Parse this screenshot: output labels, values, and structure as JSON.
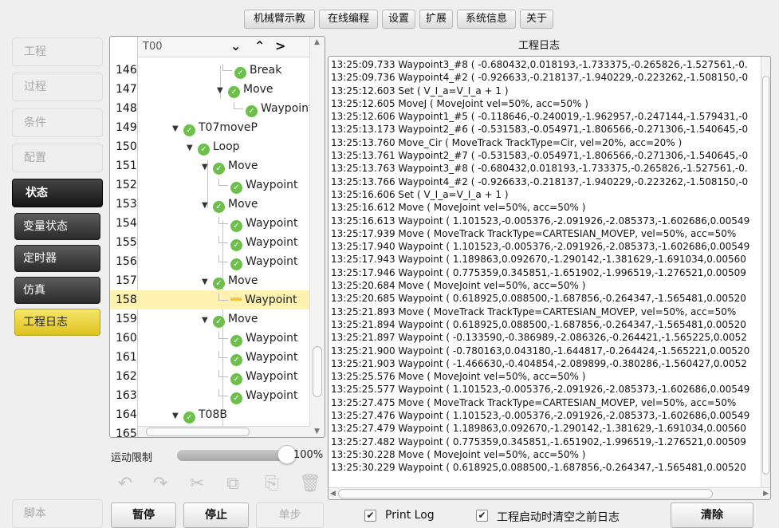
{
  "top_tabs": [
    {
      "label": "机械臂示教",
      "state": "disabled"
    },
    {
      "label": "在线编程",
      "state": "active"
    },
    {
      "label": "设置",
      "state": "normal"
    },
    {
      "label": "扩展",
      "state": "normal"
    },
    {
      "label": "系统信息",
      "state": "normal"
    },
    {
      "label": "关于",
      "state": "normal"
    }
  ],
  "sidebar": {
    "items": [
      {
        "label": "工程",
        "state": "disabled"
      },
      {
        "label": "过程",
        "state": "disabled"
      },
      {
        "label": "条件",
        "state": "disabled"
      },
      {
        "label": "配置",
        "state": "disabled"
      },
      {
        "label": "状态",
        "state": "header"
      },
      {
        "label": "变量状态",
        "state": "normal"
      },
      {
        "label": "定时器",
        "state": "normal"
      },
      {
        "label": "仿真",
        "state": "normal"
      },
      {
        "label": "工程日志",
        "state": "selected"
      }
    ],
    "script_label": "脚本"
  },
  "tree": {
    "header_title": "T00",
    "header_arrows": [
      "⌄",
      "⌃",
      ">"
    ],
    "rows": [
      {
        "line": "146",
        "label": "Break",
        "icon": "check-icon"
      },
      {
        "line": "147",
        "label": "Move",
        "icon": "check-icon",
        "caret": "▼"
      },
      {
        "line": "148",
        "label": "Waypoint",
        "icon": "check-icon"
      },
      {
        "line": "149",
        "label": "T07moveP",
        "icon": "check-icon",
        "caret": "▼"
      },
      {
        "line": "150",
        "label": "Loop",
        "icon": "check-icon",
        "caret": "▼"
      },
      {
        "line": "151",
        "label": "Move",
        "icon": "check-icon",
        "caret": "▼"
      },
      {
        "line": "152",
        "label": "Waypoint",
        "icon": "check-icon"
      },
      {
        "line": "153",
        "label": "Move",
        "icon": "check-icon",
        "caret": "▼"
      },
      {
        "line": "154",
        "label": "Waypoint",
        "icon": "check-icon"
      },
      {
        "line": "155",
        "label": "Waypoint",
        "icon": "check-icon"
      },
      {
        "line": "156",
        "label": "Waypoint",
        "icon": "check-icon"
      },
      {
        "line": "157",
        "label": "Move",
        "icon": "check-icon",
        "caret": "▼"
      },
      {
        "line": "158",
        "label": "Waypoint",
        "icon": "pencil-icon",
        "selected": true
      },
      {
        "line": "159",
        "label": "Move",
        "icon": "check-icon",
        "caret": "▼"
      },
      {
        "line": "160",
        "label": "Waypoint",
        "icon": "check-icon"
      },
      {
        "line": "161",
        "label": "Waypoint",
        "icon": "check-icon"
      },
      {
        "line": "162",
        "label": "Waypoint",
        "icon": "check-icon"
      },
      {
        "line": "163",
        "label": "Waypoint",
        "icon": "check-icon"
      },
      {
        "line": "164",
        "label": "T08B",
        "icon": "check-icon",
        "caret": "▼"
      },
      {
        "line": "165",
        "label": "",
        "icon": ""
      }
    ]
  },
  "motion_limit": {
    "label": "运动限制",
    "value_text": "100%",
    "value": 100
  },
  "toolbar_icons": [
    "undo-icon",
    "redo-icon",
    "cut-icon",
    "copy-icon",
    "paste-icon",
    "delete-icon"
  ],
  "buttons": {
    "pause": "暂停",
    "stop": "停止",
    "step": "单步",
    "clear": "清除"
  },
  "log": {
    "title": "工程日志",
    "lines": [
      "13:25:09.733  Waypoint3_#8 ( -0.680432,0.018193,-1.733375,-0.265826,-1.527561,-0.",
      "13:25:09.736  Waypoint4_#2 ( -0.926633,-0.218137,-1.940229,-0.223262,-1.508150,-0",
      "13:25:12.603  Set ( V_I_a=V_I_a + 1 )",
      "13:25:12.605  MoveJ ( MoveJoint  vel=50%, acc=50% )",
      "13:25:12.606  Waypoint1_#5 ( -0.118646,-0.240019,-1.962957,-0.247144,-1.579431,-0",
      "13:25:13.173  Waypoint2_#6 ( -0.531583,-0.054971,-1.806566,-0.271306,-1.540645,-0",
      "13:25:13.760  Move_Cir ( MoveTrack TrackType=Cir, vel=20%, acc=20% )",
      "13:25:13.761  Waypoint2_#7 ( -0.531583,-0.054971,-1.806566,-0.271306,-1.540645,-0",
      "13:25:13.763  Waypoint3_#8 ( -0.680432,0.018193,-1.733375,-0.265826,-1.527561,-0.",
      "13:25:13.766  Waypoint4_#2 ( -0.926633,-0.218137,-1.940229,-0.223262,-1.508150,-0",
      "13:25:16.606  Set ( V_I_a=V_I_a + 1 )",
      "13:25:16.612  Move ( MoveJoint  vel=50%, acc=50% )",
      "13:25:16.613  Waypoint ( 1.101523,-0.005376,-2.091926,-2.085373,-1.602686,0.00549",
      "13:25:17.939  Move ( MoveTrack TrackType=CARTESIAN_MOVEP, vel=50%, acc=50%",
      "13:25:17.940  Waypoint ( 1.101523,-0.005376,-2.091926,-2.085373,-1.602686,0.00549",
      "13:25:17.943  Waypoint ( 1.189863,0.092670,-1.290142,-1.381629,-1.691034,0.00560",
      "13:25:17.946  Waypoint ( 0.775359,0.345851,-1.651902,-1.996519,-1.276521,0.00509",
      "13:25:20.684  Move ( MoveJoint  vel=50%, acc=50% )",
      "13:25:20.685  Waypoint ( 0.618925,0.088500,-1.687856,-0.264347,-1.565481,0.00520",
      "13:25:21.893  Move ( MoveTrack TrackType=CARTESIAN_MOVEP, vel=50%, acc=50%",
      "13:25:21.894  Waypoint ( 0.618925,0.088500,-1.687856,-0.264347,-1.565481,0.00520",
      "13:25:21.897  Waypoint ( -0.133590,-0.386989,-2.086326,-0.264421,-1.565225,0.0052",
      "13:25:21.900  Waypoint ( -0.780163,0.043180,-1.644817,-0.264424,-1.565221,0.00520",
      "13:25:21.903  Waypoint ( -1.466630,-0.404854,-2.089899,-0.380286,-1.560427,0.0052",
      "13:25:25.576  Move ( MoveJoint  vel=50%, acc=50% )",
      "13:25:25.577  Waypoint ( 1.101523,-0.005376,-2.091926,-2.085373,-1.602686,0.00549",
      "13:25:27.475  Move ( MoveTrack TrackType=CARTESIAN_MOVEP, vel=50%, acc=50%",
      "13:25:27.476  Waypoint ( 1.101523,-0.005376,-2.091926,-2.085373,-1.602686,0.00549",
      "13:25:27.479  Waypoint ( 1.189863,0.092670,-1.290142,-1.381629,-1.691034,0.00560",
      "13:25:27.482  Waypoint ( 0.775359,0.345851,-1.651902,-1.996519,-1.276521,0.00509",
      "13:25:30.228  Move ( MoveJoint  vel=50%, acc=50% )",
      "13:25:30.229  Waypoint ( 0.618925,0.088500,-1.687856,-0.264347,-1.565481,0.00520"
    ]
  },
  "options": {
    "print_log": {
      "label": "Print Log",
      "checked": true
    },
    "clear_on_start": {
      "label": "工程启动时清空之前日志",
      "checked": true
    }
  }
}
